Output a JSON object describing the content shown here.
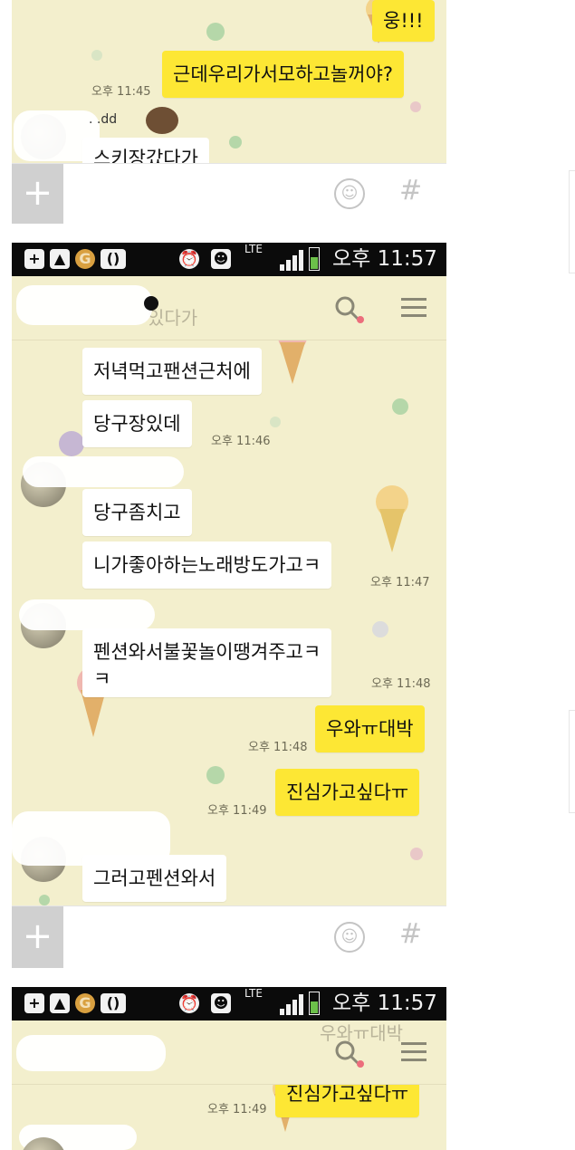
{
  "colors": {
    "chat_background": "#f3efcd",
    "my_bubble": "#fde734",
    "their_bubble": "#ffffff",
    "status_bar": "#0b0b0b",
    "battery_fill": "#6cc04a"
  },
  "icons": {
    "plus": "+",
    "hash": "#",
    "emoji": "☺",
    "search": "search-icon",
    "menu": "hamburger-menu-icon"
  },
  "status_bar": {
    "lte": "LTE",
    "time": "오후 11:57"
  },
  "panel1": {
    "messages": [
      {
        "text": "웅!!!",
        "sender": "me"
      },
      {
        "text": "근데우리가서모하고놀꺼야?",
        "sender": "me",
        "time": "오후 11:45"
      },
      {
        "text": "스키장갔다가",
        "sender": "other"
      }
    ]
  },
  "panel2": {
    "header_ghost_text": "있다가",
    "messages": [
      {
        "text": "저녁먹고팬션근처에",
        "sender": "other"
      },
      {
        "text": "당구장있데",
        "sender": "other",
        "time": "오후 11:46"
      },
      {
        "text": "당구좀치고",
        "sender": "other"
      },
      {
        "text": "니가좋아하는노래방도가고ㅋ",
        "sender": "other",
        "time": "오후 11:47"
      },
      {
        "text_line1": "펜션와서불꽃놀이땡겨주고ㅋ",
        "text_line2": "ㅋ",
        "sender": "other",
        "time": "오후 11:48"
      },
      {
        "text": "우와ㅠ대박",
        "sender": "me",
        "time": "오후 11:48"
      },
      {
        "text": "진심가고싶다ㅠ",
        "sender": "me",
        "time": "오후 11:49"
      },
      {
        "text": "그러고펜션와서",
        "sender": "other"
      }
    ]
  },
  "panel3": {
    "header_ghost_text": "우와ㅠ대박",
    "messages": [
      {
        "text": "진심가고싶다ㅠ",
        "sender": "me",
        "time": "오후 11:49"
      }
    ]
  }
}
